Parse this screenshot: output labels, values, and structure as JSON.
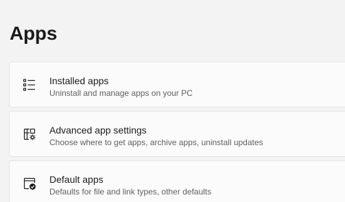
{
  "page": {
    "title": "Apps"
  },
  "items": [
    {
      "title": "Installed apps",
      "description": "Uninstall and manage apps on your PC",
      "icon": "list-icon"
    },
    {
      "title": "Advanced app settings",
      "description": "Choose where to get apps, archive apps, uninstall updates",
      "icon": "app-settings-icon"
    },
    {
      "title": "Default apps",
      "description": "Defaults for file and link types, other defaults",
      "icon": "default-apps-icon"
    }
  ],
  "colors": {
    "background": "#f3f3f3",
    "card": "#fbfbfb",
    "card_border": "#e5e5e5",
    "text_primary": "#1b1b1b",
    "text_secondary": "#606060"
  }
}
